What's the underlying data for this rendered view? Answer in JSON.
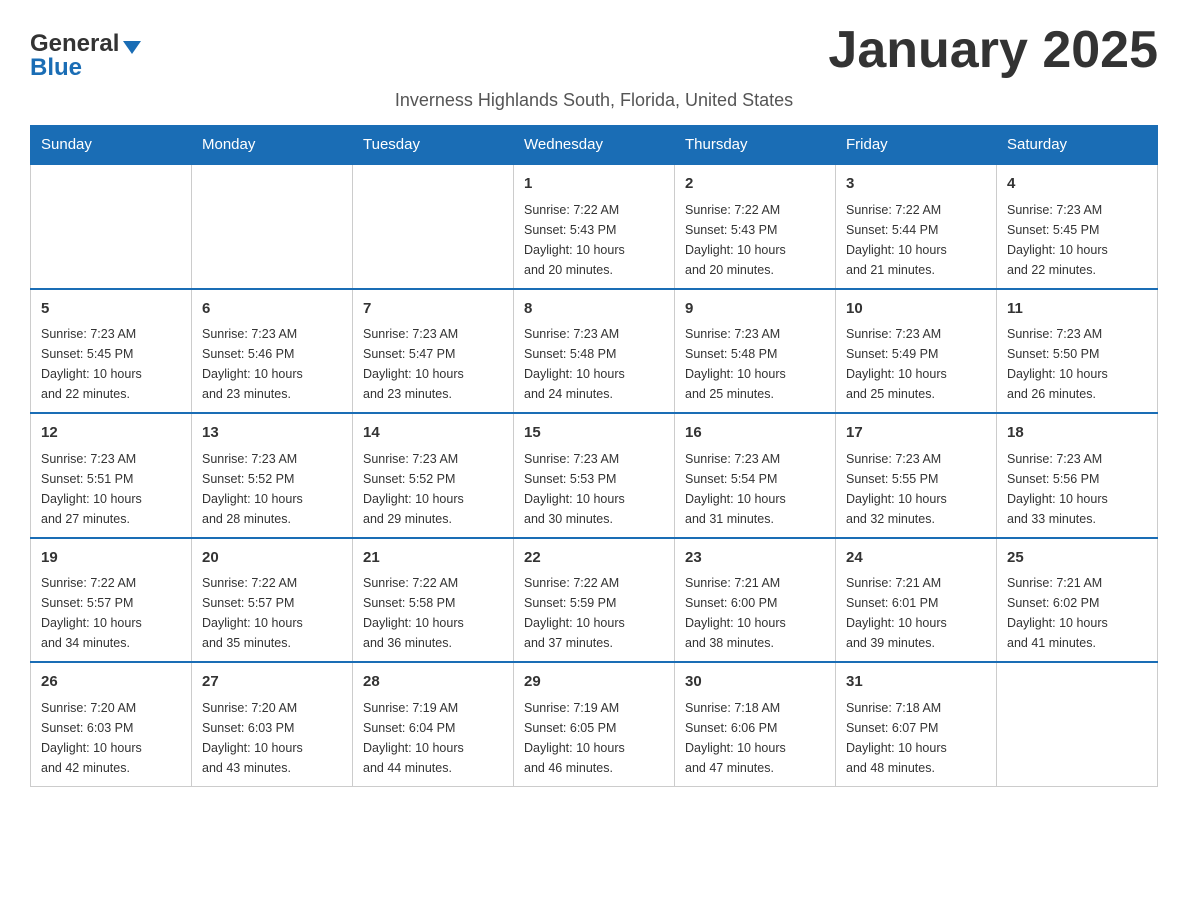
{
  "header": {
    "logo_general": "General",
    "logo_blue": "Blue",
    "month_title": "January 2025",
    "subtitle": "Inverness Highlands South, Florida, United States"
  },
  "days_of_week": [
    "Sunday",
    "Monday",
    "Tuesday",
    "Wednesday",
    "Thursday",
    "Friday",
    "Saturday"
  ],
  "weeks": [
    [
      {
        "day": "",
        "info": ""
      },
      {
        "day": "",
        "info": ""
      },
      {
        "day": "",
        "info": ""
      },
      {
        "day": "1",
        "info": "Sunrise: 7:22 AM\nSunset: 5:43 PM\nDaylight: 10 hours\nand 20 minutes."
      },
      {
        "day": "2",
        "info": "Sunrise: 7:22 AM\nSunset: 5:43 PM\nDaylight: 10 hours\nand 20 minutes."
      },
      {
        "day": "3",
        "info": "Sunrise: 7:22 AM\nSunset: 5:44 PM\nDaylight: 10 hours\nand 21 minutes."
      },
      {
        "day": "4",
        "info": "Sunrise: 7:23 AM\nSunset: 5:45 PM\nDaylight: 10 hours\nand 22 minutes."
      }
    ],
    [
      {
        "day": "5",
        "info": "Sunrise: 7:23 AM\nSunset: 5:45 PM\nDaylight: 10 hours\nand 22 minutes."
      },
      {
        "day": "6",
        "info": "Sunrise: 7:23 AM\nSunset: 5:46 PM\nDaylight: 10 hours\nand 23 minutes."
      },
      {
        "day": "7",
        "info": "Sunrise: 7:23 AM\nSunset: 5:47 PM\nDaylight: 10 hours\nand 23 minutes."
      },
      {
        "day": "8",
        "info": "Sunrise: 7:23 AM\nSunset: 5:48 PM\nDaylight: 10 hours\nand 24 minutes."
      },
      {
        "day": "9",
        "info": "Sunrise: 7:23 AM\nSunset: 5:48 PM\nDaylight: 10 hours\nand 25 minutes."
      },
      {
        "day": "10",
        "info": "Sunrise: 7:23 AM\nSunset: 5:49 PM\nDaylight: 10 hours\nand 25 minutes."
      },
      {
        "day": "11",
        "info": "Sunrise: 7:23 AM\nSunset: 5:50 PM\nDaylight: 10 hours\nand 26 minutes."
      }
    ],
    [
      {
        "day": "12",
        "info": "Sunrise: 7:23 AM\nSunset: 5:51 PM\nDaylight: 10 hours\nand 27 minutes."
      },
      {
        "day": "13",
        "info": "Sunrise: 7:23 AM\nSunset: 5:52 PM\nDaylight: 10 hours\nand 28 minutes."
      },
      {
        "day": "14",
        "info": "Sunrise: 7:23 AM\nSunset: 5:52 PM\nDaylight: 10 hours\nand 29 minutes."
      },
      {
        "day": "15",
        "info": "Sunrise: 7:23 AM\nSunset: 5:53 PM\nDaylight: 10 hours\nand 30 minutes."
      },
      {
        "day": "16",
        "info": "Sunrise: 7:23 AM\nSunset: 5:54 PM\nDaylight: 10 hours\nand 31 minutes."
      },
      {
        "day": "17",
        "info": "Sunrise: 7:23 AM\nSunset: 5:55 PM\nDaylight: 10 hours\nand 32 minutes."
      },
      {
        "day": "18",
        "info": "Sunrise: 7:23 AM\nSunset: 5:56 PM\nDaylight: 10 hours\nand 33 minutes."
      }
    ],
    [
      {
        "day": "19",
        "info": "Sunrise: 7:22 AM\nSunset: 5:57 PM\nDaylight: 10 hours\nand 34 minutes."
      },
      {
        "day": "20",
        "info": "Sunrise: 7:22 AM\nSunset: 5:57 PM\nDaylight: 10 hours\nand 35 minutes."
      },
      {
        "day": "21",
        "info": "Sunrise: 7:22 AM\nSunset: 5:58 PM\nDaylight: 10 hours\nand 36 minutes."
      },
      {
        "day": "22",
        "info": "Sunrise: 7:22 AM\nSunset: 5:59 PM\nDaylight: 10 hours\nand 37 minutes."
      },
      {
        "day": "23",
        "info": "Sunrise: 7:21 AM\nSunset: 6:00 PM\nDaylight: 10 hours\nand 38 minutes."
      },
      {
        "day": "24",
        "info": "Sunrise: 7:21 AM\nSunset: 6:01 PM\nDaylight: 10 hours\nand 39 minutes."
      },
      {
        "day": "25",
        "info": "Sunrise: 7:21 AM\nSunset: 6:02 PM\nDaylight: 10 hours\nand 41 minutes."
      }
    ],
    [
      {
        "day": "26",
        "info": "Sunrise: 7:20 AM\nSunset: 6:03 PM\nDaylight: 10 hours\nand 42 minutes."
      },
      {
        "day": "27",
        "info": "Sunrise: 7:20 AM\nSunset: 6:03 PM\nDaylight: 10 hours\nand 43 minutes."
      },
      {
        "day": "28",
        "info": "Sunrise: 7:19 AM\nSunset: 6:04 PM\nDaylight: 10 hours\nand 44 minutes."
      },
      {
        "day": "29",
        "info": "Sunrise: 7:19 AM\nSunset: 6:05 PM\nDaylight: 10 hours\nand 46 minutes."
      },
      {
        "day": "30",
        "info": "Sunrise: 7:18 AM\nSunset: 6:06 PM\nDaylight: 10 hours\nand 47 minutes."
      },
      {
        "day": "31",
        "info": "Sunrise: 7:18 AM\nSunset: 6:07 PM\nDaylight: 10 hours\nand 48 minutes."
      },
      {
        "day": "",
        "info": ""
      }
    ]
  ]
}
